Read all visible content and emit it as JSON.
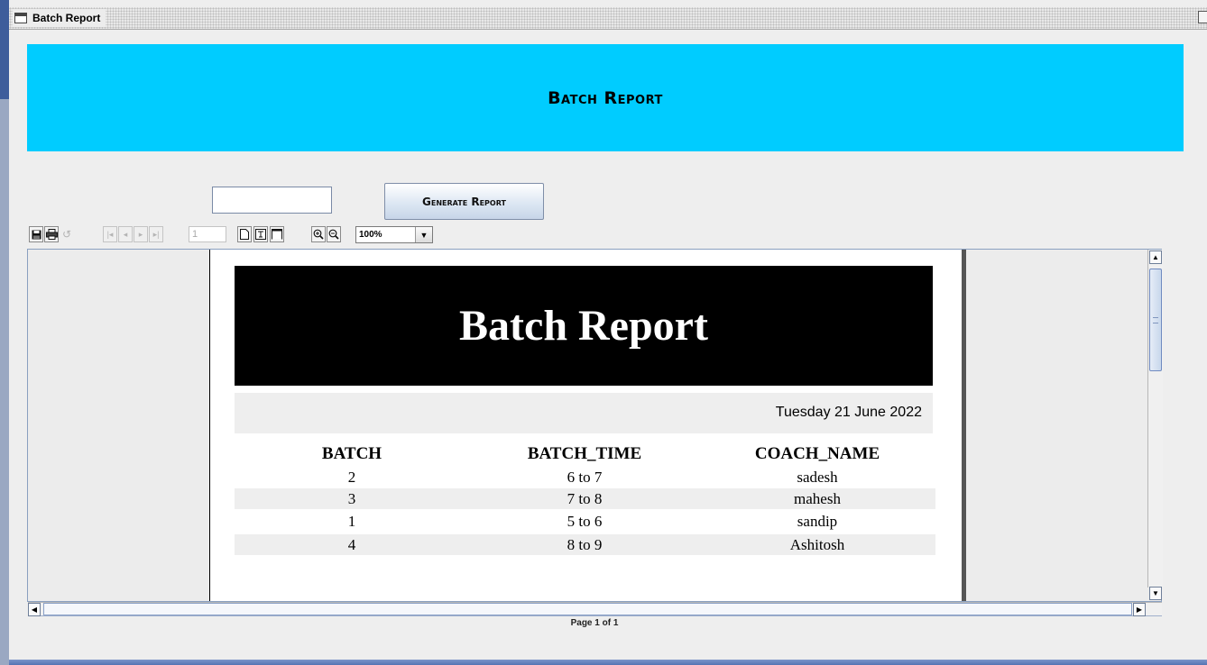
{
  "window": {
    "title": "Batch Report"
  },
  "banner": {
    "title": "Batch Report",
    "color": "#00ccff"
  },
  "form": {
    "input_value": "",
    "generate_label": "Generate Report"
  },
  "viewer_toolbar": {
    "icons": [
      "save-icon",
      "print-icon",
      "reload-icon",
      "first-page-icon",
      "previous-page-icon",
      "next-page-icon",
      "last-page-icon",
      "actual-size-icon",
      "fit-page-icon",
      "fit-width-icon",
      "zoom-in-icon",
      "zoom-out-icon"
    ],
    "page_number": "1",
    "zoom": "100%"
  },
  "report": {
    "title": "Batch Report",
    "date": "Tuesday 21 June 2022",
    "columns": [
      "BATCH",
      "BATCH_TIME",
      "COACH_NAME"
    ],
    "rows": [
      [
        "2",
        "6 to 7",
        "sadesh"
      ],
      [
        "3",
        "7 to 8",
        "mahesh"
      ],
      [
        "1",
        "5 to 6",
        "sandip"
      ],
      [
        "4",
        "8 to 9",
        "Ashitosh"
      ]
    ]
  },
  "status": {
    "page_label": "Page 1 of 1"
  }
}
